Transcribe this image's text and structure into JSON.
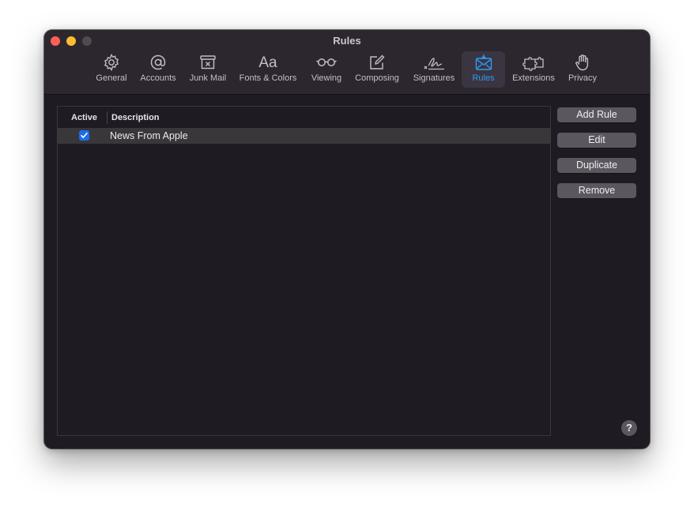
{
  "window": {
    "title": "Rules"
  },
  "toolbar": {
    "items": [
      {
        "label": "General",
        "icon": "gear-icon"
      },
      {
        "label": "Accounts",
        "icon": "at-sign-icon"
      },
      {
        "label": "Junk Mail",
        "icon": "junk-tray-icon"
      },
      {
        "label": "Fonts & Colors",
        "icon": "fonts-icon",
        "glyph": "Aa"
      },
      {
        "label": "Viewing",
        "icon": "glasses-icon"
      },
      {
        "label": "Composing",
        "icon": "compose-icon"
      },
      {
        "label": "Signatures",
        "icon": "signature-icon"
      },
      {
        "label": "Rules",
        "icon": "rules-envelope-icon",
        "selected": true
      },
      {
        "label": "Extensions",
        "icon": "puzzle-icon"
      },
      {
        "label": "Privacy",
        "icon": "hand-icon"
      }
    ],
    "accent_color": "#2d9bf5"
  },
  "rules_table": {
    "columns": [
      "Active",
      "Description"
    ],
    "rows": [
      {
        "active": true,
        "description": "News From Apple"
      }
    ]
  },
  "buttons": {
    "add_rule": "Add Rule",
    "edit": "Edit",
    "duplicate": "Duplicate",
    "remove": "Remove",
    "help": "?"
  }
}
